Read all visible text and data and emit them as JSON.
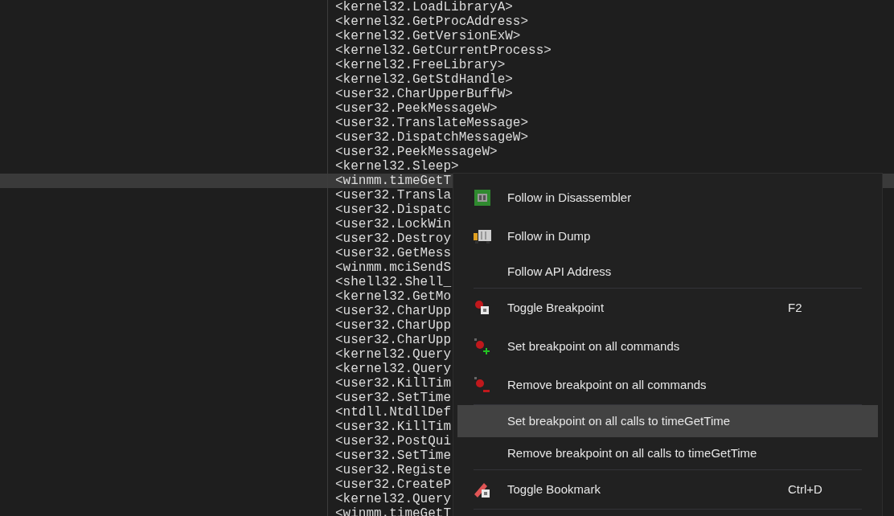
{
  "listing": {
    "rows": [
      {
        "text": "<kernel32.LoadLibraryA>",
        "selected": false
      },
      {
        "text": "<kernel32.GetProcAddress>",
        "selected": false
      },
      {
        "text": "<kernel32.GetVersionExW>",
        "selected": false
      },
      {
        "text": "<kernel32.GetCurrentProcess>",
        "selected": false
      },
      {
        "text": "<kernel32.FreeLibrary>",
        "selected": false
      },
      {
        "text": "<kernel32.GetStdHandle>",
        "selected": false
      },
      {
        "text": "<user32.CharUpperBuffW>",
        "selected": false
      },
      {
        "text": "<user32.PeekMessageW>",
        "selected": false
      },
      {
        "text": "<user32.TranslateMessage>",
        "selected": false
      },
      {
        "text": "<user32.DispatchMessageW>",
        "selected": false
      },
      {
        "text": "<user32.PeekMessageW>",
        "selected": false
      },
      {
        "text": "<kernel32.Sleep>",
        "selected": false
      },
      {
        "text": "<winmm.timeGetT",
        "selected": true
      },
      {
        "text": "<user32.Transla",
        "selected": false
      },
      {
        "text": "<user32.Dispatc",
        "selected": false
      },
      {
        "text": "<user32.LockWin",
        "selected": false
      },
      {
        "text": "<user32.Destroy",
        "selected": false
      },
      {
        "text": "<user32.GetMess",
        "selected": false
      },
      {
        "text": "<winmm.mciSendS",
        "selected": false
      },
      {
        "text": "<shell32.Shell_",
        "selected": false
      },
      {
        "text": "<kernel32.GetMo",
        "selected": false
      },
      {
        "text": "<user32.CharUpp",
        "selected": false
      },
      {
        "text": "<user32.CharUpp",
        "selected": false
      },
      {
        "text": "<user32.CharUpp",
        "selected": false
      },
      {
        "text": "<kernel32.Query",
        "selected": false
      },
      {
        "text": "<kernel32.Query",
        "selected": false
      },
      {
        "text": "<user32.KillTim",
        "selected": false
      },
      {
        "text": "<user32.SetTime",
        "selected": false
      },
      {
        "text": "<ntdll.NtdllDef",
        "selected": false
      },
      {
        "text": "<user32.KillTim",
        "selected": false
      },
      {
        "text": "<user32.PostQui",
        "selected": false
      },
      {
        "text": "<user32.SetTime",
        "selected": false
      },
      {
        "text": "<user32.Registe",
        "selected": false
      },
      {
        "text": "<user32.CreateP",
        "selected": false
      },
      {
        "text": "<kernel32.Query",
        "selected": false
      },
      {
        "text": "<winmm.timeGetT",
        "selected": false
      }
    ]
  },
  "context_menu": {
    "items": [
      {
        "kind": "item",
        "label": "Follow in Disassembler",
        "selected": false
      },
      {
        "kind": "item",
        "label": "Follow in Dump",
        "selected": false
      },
      {
        "kind": "item",
        "label": "Follow API Address",
        "selected": false
      },
      {
        "kind": "separator"
      },
      {
        "kind": "item",
        "label": "Toggle Breakpoint",
        "shortcut": "F2",
        "selected": false
      },
      {
        "kind": "item",
        "label": "Set breakpoint on all commands",
        "selected": false
      },
      {
        "kind": "item",
        "label": "Remove breakpoint on all commands",
        "selected": false
      },
      {
        "kind": "separator"
      },
      {
        "kind": "item",
        "label": "Set breakpoint on all calls to timeGetTime",
        "selected": true
      },
      {
        "kind": "item",
        "label": "Remove breakpoint on all calls to timeGetTime",
        "selected": false
      },
      {
        "kind": "separator"
      },
      {
        "kind": "item",
        "label": "Toggle Bookmark",
        "shortcut": "Ctrl+D",
        "selected": false
      },
      {
        "kind": "separator"
      }
    ]
  }
}
